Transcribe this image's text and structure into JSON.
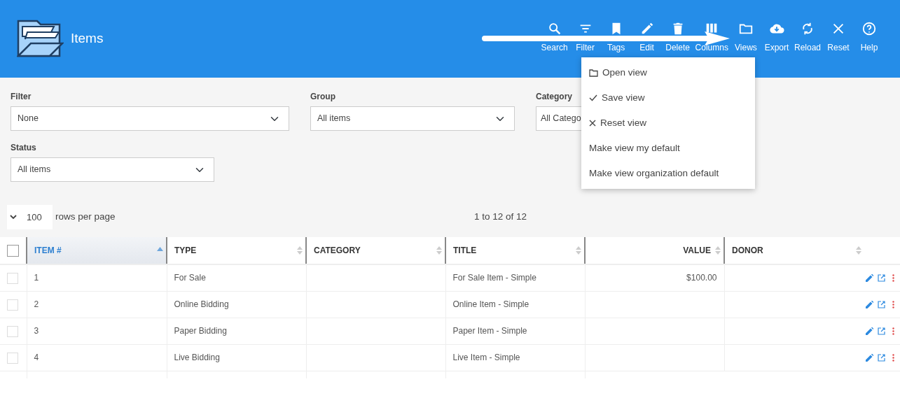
{
  "header": {
    "title": "Items",
    "toolbar": [
      {
        "label": "Search"
      },
      {
        "label": "Filter"
      },
      {
        "label": "Tags"
      },
      {
        "label": "Edit"
      },
      {
        "label": "Delete"
      },
      {
        "label": "Columns"
      },
      {
        "label": "Views"
      },
      {
        "label": "Export"
      },
      {
        "label": "Reload"
      },
      {
        "label": "Reset"
      },
      {
        "label": "Help"
      }
    ]
  },
  "views_menu": [
    {
      "label": "Open view",
      "kind": "folder"
    },
    {
      "label": "Save view",
      "kind": "check"
    },
    {
      "label": "Reset view",
      "kind": "cross"
    },
    {
      "label": "Make view my default",
      "kind": "text"
    },
    {
      "label": "Make view organization default",
      "kind": "text"
    }
  ],
  "filters": [
    {
      "label": "Filter",
      "value": "None"
    },
    {
      "label": "Group",
      "value": "All items"
    },
    {
      "label": "Category",
      "value": "All Catego"
    },
    {
      "label": "Status",
      "value": "All items"
    }
  ],
  "pagination": {
    "rows_per_page": "100",
    "rows_label": "rows per page",
    "range": "1 to 12 of 12"
  },
  "table": {
    "select_all": {
      "checked": false
    },
    "columns": [
      {
        "label": "ITEM #",
        "sorted": true
      },
      {
        "label": "TYPE",
        "sorted": false
      },
      {
        "label": "CATEGORY",
        "sorted": false
      },
      {
        "label": "TITLE",
        "sorted": false
      },
      {
        "label": "VALUE",
        "sorted": false
      },
      {
        "label": "DONOR",
        "sorted": false
      }
    ],
    "rows": [
      {
        "checked": false,
        "cells": [
          "1",
          "For Sale",
          "",
          "For Sale Item - Simple",
          "$100.00",
          ""
        ]
      },
      {
        "checked": false,
        "cells": [
          "2",
          "Online Bidding",
          "",
          "Online Item - Simple",
          "",
          ""
        ]
      },
      {
        "checked": false,
        "cells": [
          "3",
          "Paper Bidding",
          "",
          "Paper Item - Simple",
          "",
          ""
        ]
      },
      {
        "checked": false,
        "cells": [
          "4",
          "Live Bidding",
          "",
          "Live Item - Simple",
          "",
          ""
        ]
      }
    ]
  }
}
